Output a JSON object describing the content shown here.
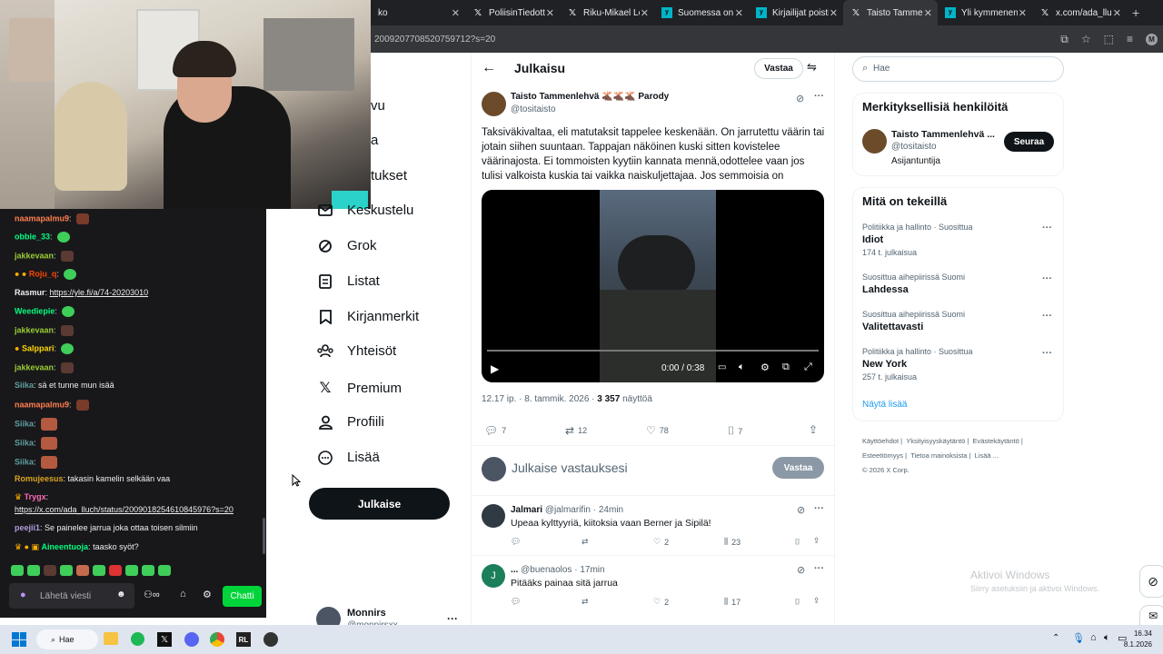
{
  "browser": {
    "tabs": [
      {
        "label": "ko",
        "icon": "x-icon",
        "active": false
      },
      {
        "label": "PoliisinTiedotte",
        "icon": "x-icon",
        "active": false
      },
      {
        "label": "Riku-Mikael Lep",
        "icon": "x-icon",
        "active": false
      },
      {
        "label": "Suomessa on ny",
        "icon": "yle-icon",
        "active": false
      },
      {
        "label": "Kirjailijat poistiv",
        "icon": "yle-icon",
        "active": false
      },
      {
        "label": "Taisto Tammenle",
        "icon": "x-icon",
        "active": true
      },
      {
        "label": "Yli kymmenen t",
        "icon": "yle-icon",
        "active": false
      },
      {
        "label": "x.com/ada_lluch",
        "icon": "x-icon",
        "active": false
      }
    ],
    "url": "2009207708520759712?s=20"
  },
  "chat": {
    "messages": [
      {
        "user": "naamapalmu9",
        "text": "",
        "color": "#ff7f50"
      },
      {
        "user": "obbie_33",
        "text": "",
        "color": "#00ff7f"
      },
      {
        "user": "jakkevaan",
        "text": "",
        "color": "#9acd32"
      },
      {
        "user": "Roju_q",
        "text": "",
        "color": "#ff4500"
      },
      {
        "user": "Rasmur",
        "text": "https://yle.fi/a/74-20203010",
        "color": "#ffffff"
      },
      {
        "user": "Weediepie",
        "text": "",
        "color": "#00ff7f"
      },
      {
        "user": "jakkevaan",
        "text": "",
        "color": "#9acd32"
      },
      {
        "user": "Salppari",
        "text": "",
        "color": "#ffd700"
      },
      {
        "user": "jakkevaan",
        "text": "",
        "color": "#9acd32"
      },
      {
        "user": "Siika",
        "text": "sä et tunne mun isää",
        "color": "#5f9ea0"
      },
      {
        "user": "naamapalmu9",
        "text": "",
        "color": "#ff7f50"
      },
      {
        "user": "Siika",
        "text": "",
        "color": "#5f9ea0"
      },
      {
        "user": "Siika",
        "text": "",
        "color": "#5f9ea0"
      },
      {
        "user": "Siika",
        "text": "",
        "color": "#5f9ea0"
      },
      {
        "user": "Romujeesus",
        "text": "takasin kamelin selkään vaa",
        "color": "#daa520"
      },
      {
        "user": "Trygx",
        "text": "",
        "color": "#ff69b4"
      },
      {
        "user": "",
        "text": "https://x.com/ada_lluch/status/2009018254610845976?s=20",
        "color": "#ffffff"
      },
      {
        "user": "peejii1",
        "text": "Se painelee jarrua joka ottaa toisen silmiin",
        "color": "#b19cd9"
      },
      {
        "user": "Aineentuoja",
        "text": "taasko syöt?",
        "color": "#00ff7f"
      }
    ],
    "input_placeholder": "Lähetä viesti",
    "send_label": "Chatti"
  },
  "nav": {
    "partial_items": [
      "vu",
      "a",
      "tukset"
    ],
    "items": [
      {
        "label": "Keskustelu",
        "icon": "mail-icon"
      },
      {
        "label": "Grok",
        "icon": "grok-icon"
      },
      {
        "label": "Listat",
        "icon": "list-icon"
      },
      {
        "label": "Kirjanmerkit",
        "icon": "bookmark-icon"
      },
      {
        "label": "Yhteisöt",
        "icon": "communities-icon"
      },
      {
        "label": "Premium",
        "icon": "x-logo-icon"
      },
      {
        "label": "Profiili",
        "icon": "profile-icon"
      },
      {
        "label": "Lisää",
        "icon": "more-circle-icon"
      }
    ],
    "post_button": "Julkaise",
    "account_name": "Monnirs",
    "account_handle": "@monnirsxx"
  },
  "post": {
    "header_title": "Julkaisu",
    "reply_label": "Vastaa",
    "author_name": "Taisto Tammenlehvä 🫎🫎🫎 Parody",
    "author_handle": "@tositaisto",
    "text": "Taksiväkivaltaa, eli matutaksit tappelee keskenään. On jarrutettu väärin tai jotain siihen suuntaan. Tappajan näköinen kuski sitten kovistelee väärinajosta. Ei tommoisten kyytiin kannata mennä,odottelee vaan jos tulisi valkoista kuskia tai vaikka naiskuljettajaa. Jos semmoisia on",
    "video_time": "0:00 / 0:38",
    "video_progress": 0.0,
    "meta": "12.17 ip. · 8. tammik. 2026 · ",
    "views_count": "3 357",
    "views_label": " näyttöä",
    "stats": {
      "replies": "7",
      "reposts": "12",
      "likes": "78",
      "bookmarks": "7"
    },
    "compose_placeholder": "Julkaise vastauksesi",
    "compose_button": "Vastaa"
  },
  "replies": [
    {
      "name": "Jalmari",
      "handle": "@jalmarifin · 24min",
      "text": "Upeaa kylttyyriä, kiitoksia vaan Berner ja Sipilä!",
      "likes": "2",
      "views": "23",
      "avatar_letter": ""
    },
    {
      "name": "...",
      "handle": "@buenaolos · 17min",
      "text": "Pitääks painaa sitä jarrua",
      "likes": "2",
      "views": "17",
      "avatar_letter": "J"
    }
  ],
  "right": {
    "search_placeholder": "Hae",
    "relevant_title": "Merkityksellisiä henkilöitä",
    "relevant_name": "Taisto Tammenlehvä ...",
    "relevant_handle": "@tositaisto",
    "relevant_bio": "Asijantuntija",
    "follow_label": "Seuraa",
    "trending_title": "Mitä on tekeillä",
    "trends": [
      {
        "context": "Politiikka ja hallinto · Suosittua",
        "name": "Idiot",
        "count": "174 t. julkaisua"
      },
      {
        "context": "Suosittua aihepiirissä Suomi",
        "name": "Lahdessa",
        "count": ""
      },
      {
        "context": "Suosittua aihepiirissä Suomi",
        "name": "Valitettavasti",
        "count": ""
      },
      {
        "context": "Politiikka ja hallinto · Suosittua",
        "name": "New York",
        "count": "257 t. julkaisua"
      }
    ],
    "show_more": "Näytä lisää",
    "footer": [
      "Käyttöehdot",
      "Yksityisyyskäytäntö",
      "Evästekäytäntö",
      "Esteettömyys",
      "Tietoa mainoksista",
      "Lisää ...",
      "© 2026 X Corp."
    ]
  },
  "watermark": {
    "title": "Aktivoi Windows",
    "subtitle": "Siirry asetuksiin ja aktivoi Windows."
  },
  "taskbar": {
    "search": "Hae",
    "time": "16.34",
    "date": "8.1.2026"
  }
}
